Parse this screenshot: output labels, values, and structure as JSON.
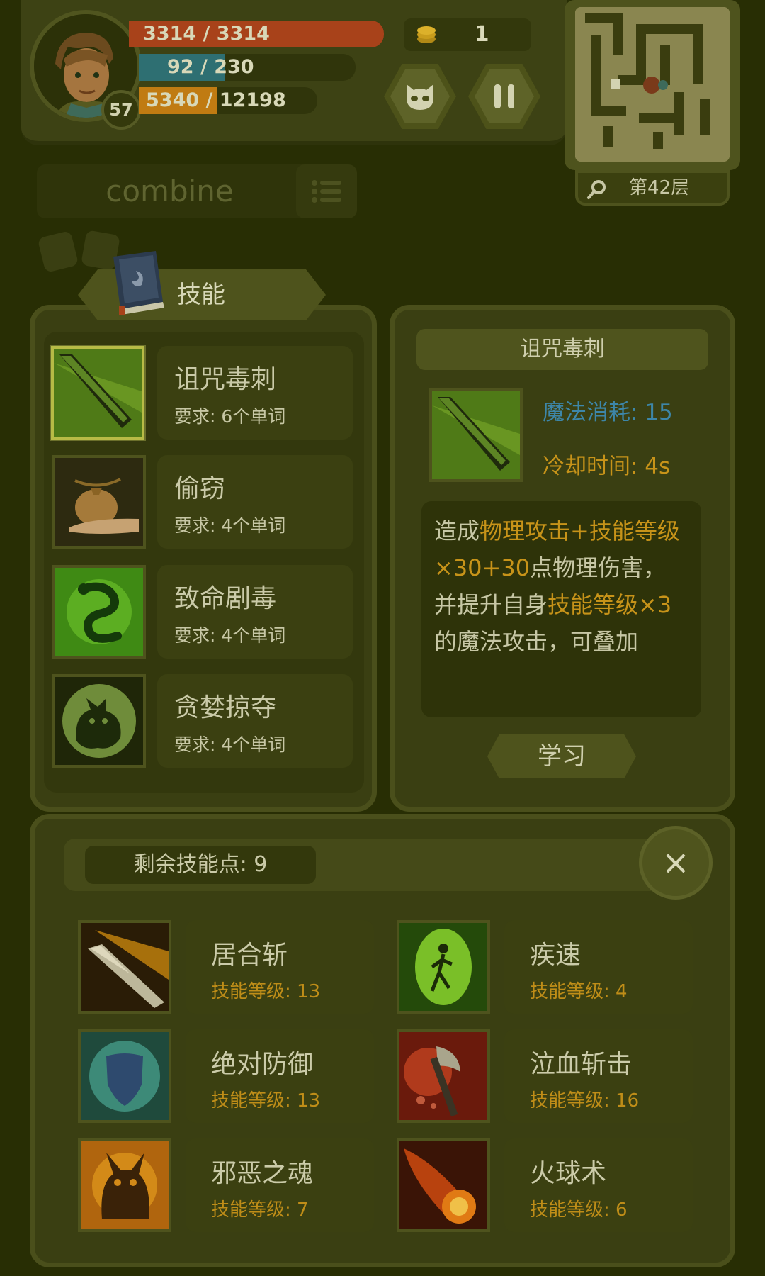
{
  "colors": {
    "background": "#282e04",
    "hp": "#a8421a",
    "mp": "#2e6f72",
    "exp": "#c07b12",
    "highlight": "#c79319",
    "mana_label": "#3d86a8",
    "cooldown_label": "#c79319"
  },
  "player": {
    "level": "57",
    "hp_text": "3314 / 3314",
    "hp_fraction": 1.0,
    "mp_text": "92 / 230",
    "mp_fraction": 0.4,
    "exp_text": "5340 / 12198",
    "exp_fraction": 0.438
  },
  "hud": {
    "coins": "1",
    "monster_button_icon": "monster-face-icon",
    "pause_button_icon": "pause-icon",
    "floor_label": "第42层",
    "search_icon": "magnifier-icon"
  },
  "search": {
    "text": "combine",
    "list_icon": "list-icon"
  },
  "skills_tab": {
    "label": "技能",
    "icon": "spellbook-icon"
  },
  "learnable_skills": [
    {
      "name": "诅咒毒刺",
      "requirement": "要求: 6个单词",
      "icon": "green-blade-icon",
      "selected": true
    },
    {
      "name": "偷窃",
      "requirement": "要求: 4个单词",
      "icon": "money-bag-icon",
      "selected": false
    },
    {
      "name": "致命剧毒",
      "requirement": "要求: 4个单词",
      "icon": "green-serpent-icon",
      "selected": false
    },
    {
      "name": "贪婪掠夺",
      "requirement": "要求: 4个单词",
      "icon": "moon-beast-icon",
      "selected": false
    }
  ],
  "detail": {
    "title": "诅咒毒刺",
    "mana_cost": "魔法消耗: 15",
    "cooldown": "冷却时间: 4s",
    "desc_1": "造成",
    "desc_2": "物理攻击+技能等级×30+30",
    "desc_3": "点物理伤害，并提升自身",
    "desc_4": "技能等级×3",
    "desc_5": "的魔法攻击，可叠加",
    "learn_button": "学习"
  },
  "owned": {
    "points_label": "剩余技能点: 9",
    "close_icon": "close-icon",
    "close_text": "×",
    "skills": [
      {
        "name": "居合斩",
        "level": "技能等级: 13",
        "icon": "flaming-sword-icon"
      },
      {
        "name": "疾速",
        "level": "技能等级: 4",
        "icon": "running-figure-icon"
      },
      {
        "name": "绝对防御",
        "level": "技能等级: 13",
        "icon": "shield-icon"
      },
      {
        "name": "泣血斩击",
        "level": "技能等级: 16",
        "icon": "bloody-axe-icon"
      },
      {
        "name": "邪恶之魂",
        "level": "技能等级: 7",
        "icon": "demon-icon"
      },
      {
        "name": "火球术",
        "level": "技能等级: 6",
        "icon": "fireball-icon"
      }
    ]
  }
}
